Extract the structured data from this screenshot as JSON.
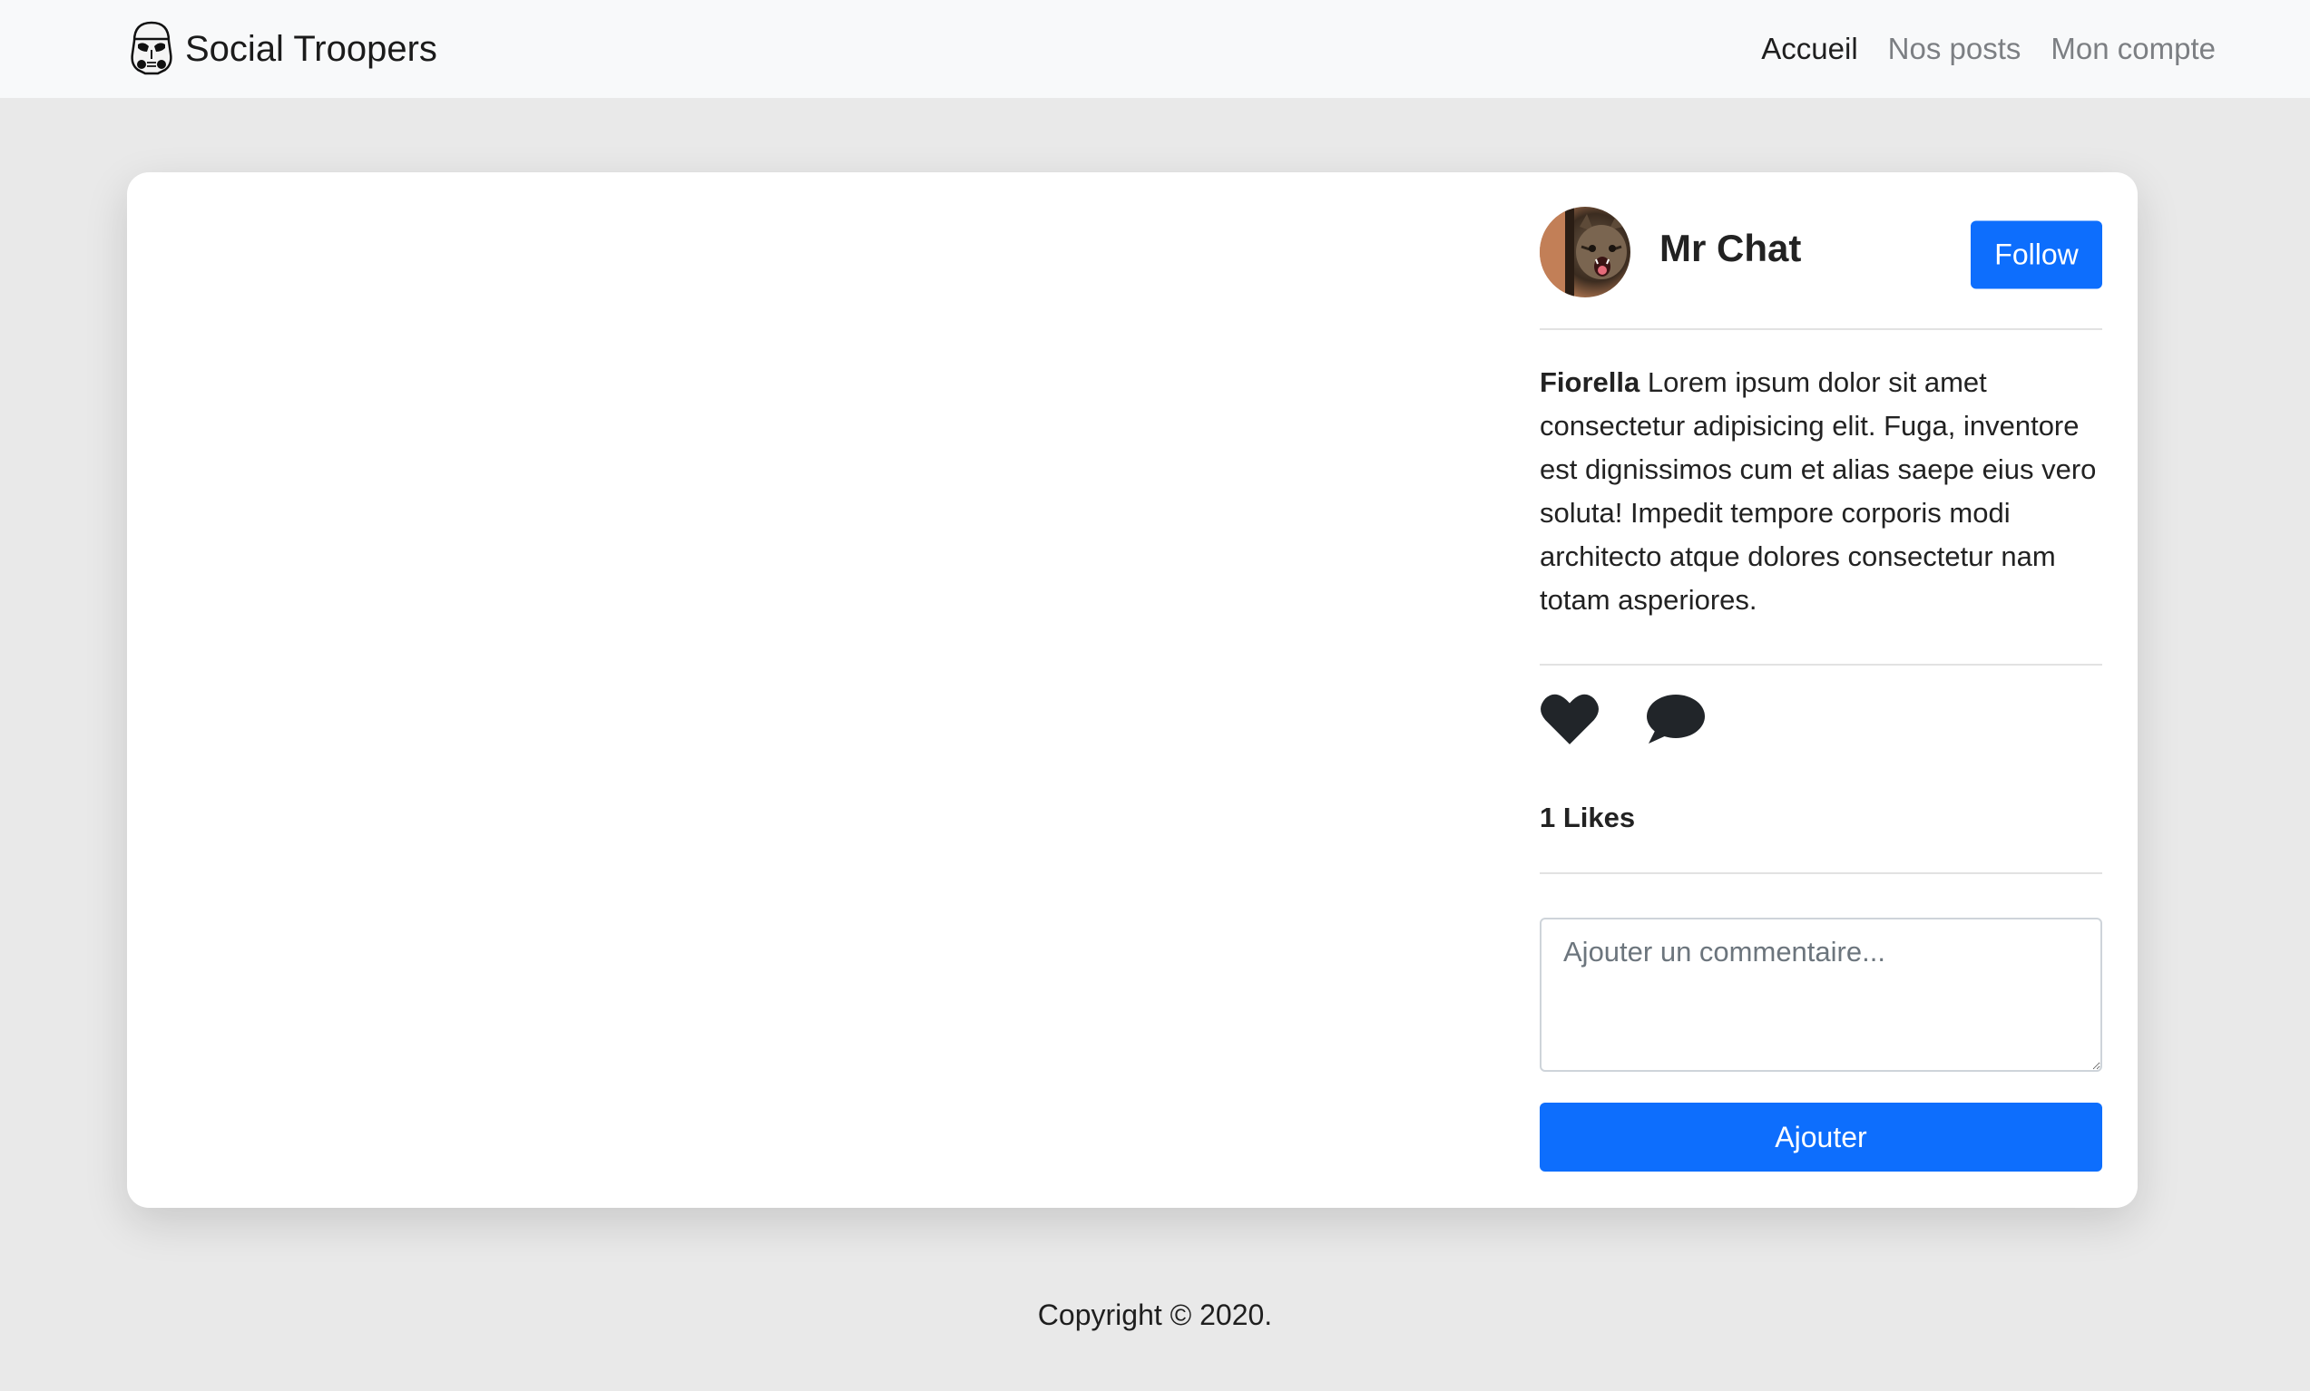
{
  "navbar": {
    "brand": "Social Troopers",
    "brand_icon": "stormtrooper-helmet-icon",
    "links": [
      {
        "label": "Accueil",
        "active": true
      },
      {
        "label": "Nos posts",
        "active": false
      },
      {
        "label": "Mon compte",
        "active": false
      }
    ]
  },
  "post": {
    "author": {
      "name": "Mr Chat",
      "avatar": "cat-avatar"
    },
    "follow_label": "Follow",
    "caption_author": "Fiorella",
    "caption_text": "Lorem ipsum dolor sit amet consectetur adipisicing elit. Fuga, inventore est dignissimos cum et alias saepe eius vero soluta! Impedit tempore corporis modi architecto atque dolores consectetur nam totam asperiores.",
    "actions": {
      "like_icon": "heart-icon",
      "comment_icon": "speech-bubble-icon"
    },
    "likes": "1 Likes",
    "comment_placeholder": "Ajouter un commentaire...",
    "add_label": "Ajouter"
  },
  "footer": {
    "text": "Copyright © 2020."
  },
  "colors": {
    "primary": "#0d6efd",
    "navbar_bg": "#f8f9fa",
    "page_bg": "#e9e9e9",
    "card_bg": "#ffffff"
  }
}
